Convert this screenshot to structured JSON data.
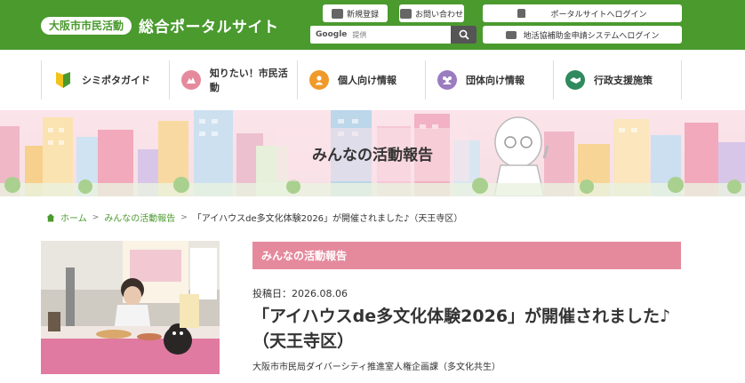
{
  "header": {
    "logo_pill": "大阪市市民活動",
    "logo_title": "総合ポータルサイト",
    "btn_register": "新規登録",
    "btn_contact": "お問い合わせ",
    "btn_portal_login": "ポータルサイトへログイン",
    "btn_grant_login": "地活協補助金申請システムへログイン",
    "search_brand": "Google",
    "search_placeholder": "提供"
  },
  "nav": {
    "items": [
      {
        "label": "シミポタガイド",
        "icon": "beginner-leaf-icon",
        "color": "#4a9a2e"
      },
      {
        "label": "知りたい！市民活動",
        "icon": "mountain-icon",
        "color": "#e58a9d"
      },
      {
        "label": "個人向け情報",
        "icon": "person-icon",
        "color": "#ef9a2a"
      },
      {
        "label": "団体向け情報",
        "icon": "group-icon",
        "color": "#9b7cc0"
      },
      {
        "label": "行政支援施策",
        "icon": "handshake-icon",
        "color": "#2f8a5e"
      }
    ]
  },
  "banner": {
    "title": "みんなの活動報告"
  },
  "breadcrumb": {
    "home": "ホーム",
    "section": "みんなの活動報告",
    "current": "「アイハウスde多文化体験2026」が開催されました♪（天王寺区）",
    "sep": ">"
  },
  "article": {
    "section_label": "みんなの活動報告",
    "posted": "投稿日：2026.08.06",
    "title": "「アイハウスde多文化体験2026」が開催されました♪（天王寺区）",
    "department": "大阪市市民局ダイバーシティ推進室人権企画課（多文化共生）"
  },
  "colors": {
    "header_green": "#4a9a2e",
    "section_pink": "#e58a9d",
    "banner_pink": "#fbe4ea"
  }
}
